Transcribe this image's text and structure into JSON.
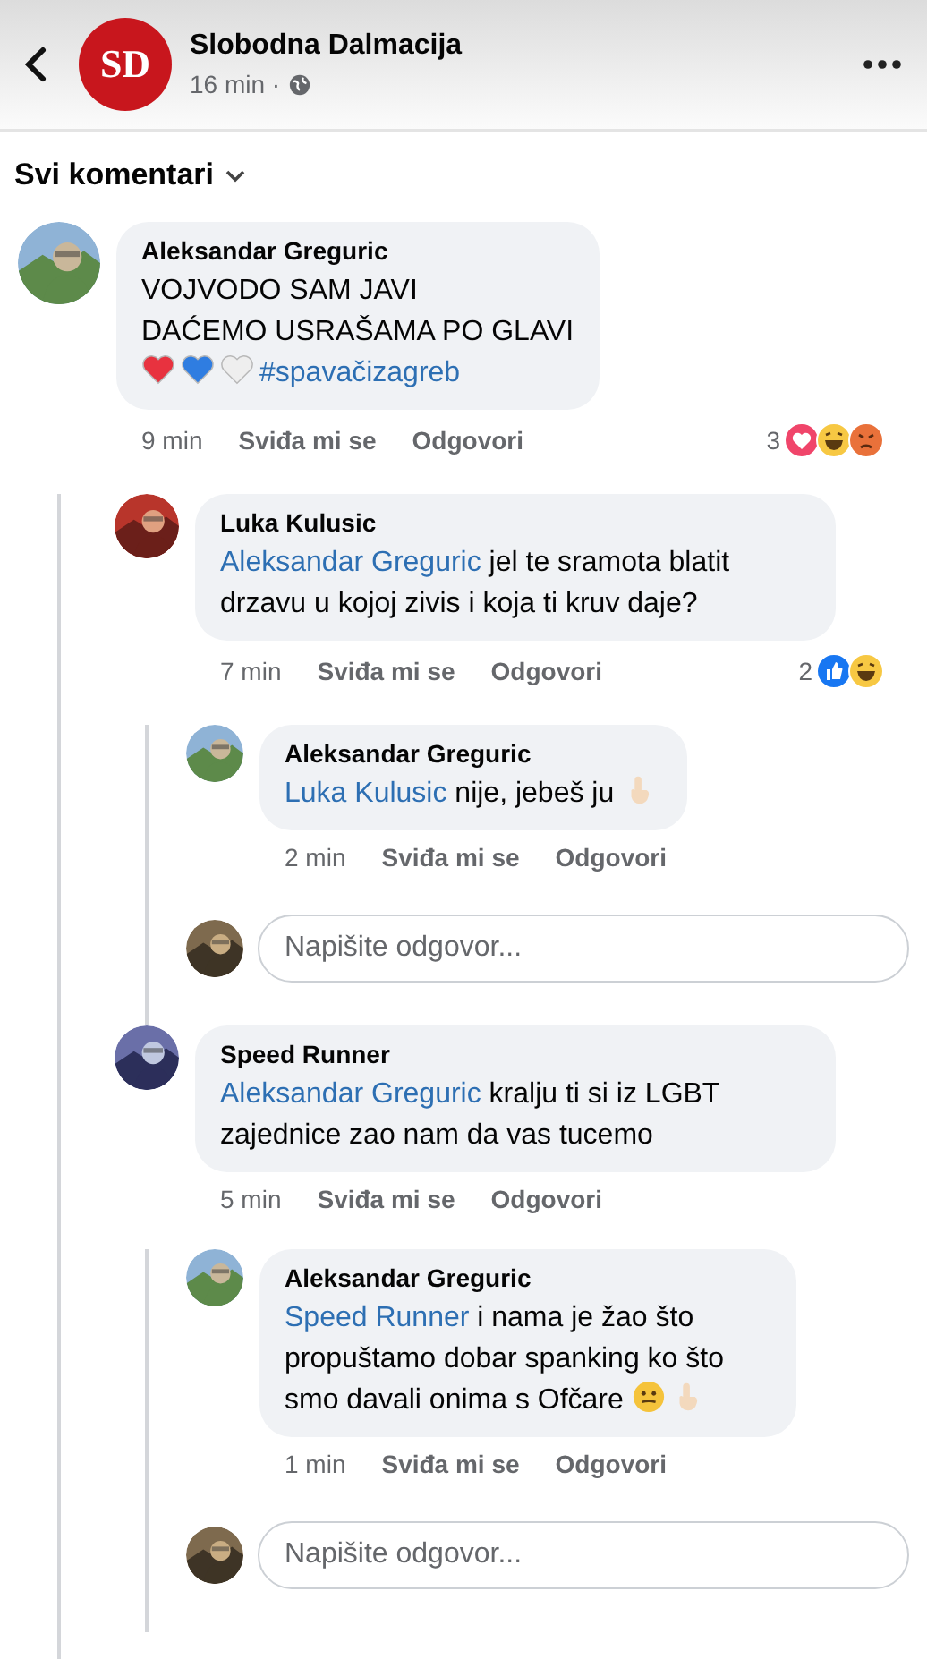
{
  "header": {
    "page_name": "Slobodna Dalmacija",
    "logo_text": "SD",
    "time": "16 min ·"
  },
  "filter": {
    "label": "Svi komentari"
  },
  "comments": [
    {
      "author": "Aleksandar Greguric",
      "text": "VOJVODO SAM JAVI\nDAĆEMO USRAŠAMA PO GLAVI\n",
      "emojis": [
        {
          "kind": "heart",
          "color": "#e8323f"
        },
        {
          "kind": "heart",
          "color": "#2f7de1"
        },
        {
          "kind": "heart",
          "color": "#eeeeee"
        }
      ],
      "hashtag": "#spavačizagreb",
      "time": "9 min",
      "like_label": "Sviđa mi se",
      "reply_label": "Odgovori",
      "reactions": {
        "count": "3",
        "icons": [
          {
            "kind": "love"
          },
          {
            "kind": "haha"
          },
          {
            "kind": "angry"
          }
        ]
      },
      "replies": [
        {
          "author": "Luka Kulusic",
          "mention": "Aleksandar Greguric",
          "text": " jel te sramota blatit drzavu u kojoj zivis i koja ti kruv daje?",
          "time": "7 min",
          "like_label": "Sviđa mi se",
          "reply_label": "Odgovori",
          "reactions": {
            "count": "2",
            "icons": [
              {
                "kind": "like"
              },
              {
                "kind": "haha"
              }
            ]
          },
          "replies": [
            {
              "author": "Aleksandar Greguric",
              "mention": "Luka Kulusic",
              "text": " nije, jebeš ju ",
              "emojis": [
                {
                  "kind": "hand",
                  "color": "#f3d9bd"
                }
              ],
              "time": "2 min",
              "like_label": "Sviđa mi se",
              "reply_label": "Odgovori"
            }
          ],
          "reply_field": {
            "placeholder": "Napišite odgovor..."
          }
        },
        {
          "author": "Speed Runner",
          "mention": "Aleksandar Greguric",
          "text": " kralju ti si iz LGBT zajednice zao nam da vas tucemo",
          "time": "5 min",
          "like_label": "Sviđa mi se",
          "reply_label": "Odgovori",
          "replies": [
            {
              "author": "Aleksandar Greguric",
              "mention": "Speed Runner",
              "text": " i nama je žao što propuštamo dobar spanking ko što smo davali onima s Ofčare ",
              "emojis": [
                {
                  "kind": "smiley",
                  "color": "#f5c33b"
                },
                {
                  "kind": "hand",
                  "color": "#f3d9bd"
                }
              ],
              "time": "1 min",
              "like_label": "Sviđa mi se",
              "reply_label": "Odgovori"
            }
          ],
          "reply_field": {
            "placeholder": "Napišite odgovor..."
          }
        }
      ]
    }
  ]
}
